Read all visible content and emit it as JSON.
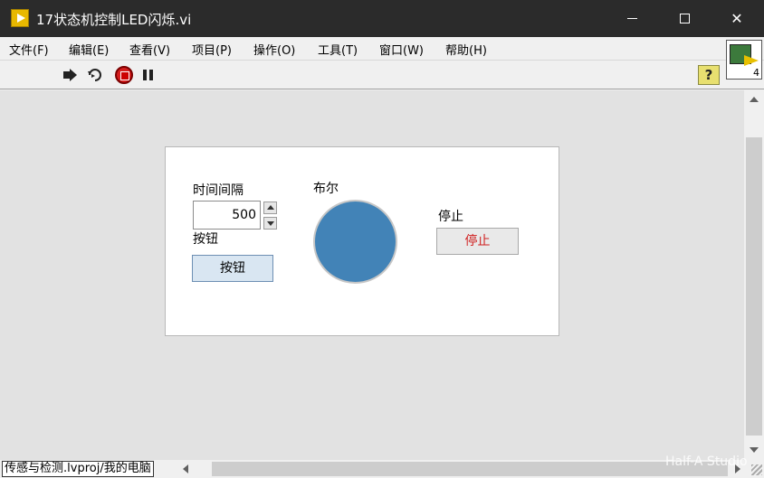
{
  "window": {
    "title": "17状态机控制LED闪烁.vi",
    "icon": "labview-vi-icon"
  },
  "menu": [
    "文件(F)",
    "编辑(E)",
    "查看(V)",
    "项目(P)",
    "操作(O)",
    "工具(T)",
    "窗口(W)",
    "帮助(H)"
  ],
  "toolbar": {
    "help_label": "?",
    "connector_number": "4"
  },
  "front_panel": {
    "numeric_label": "时间间隔",
    "numeric_value": "500",
    "button_label": "按钮",
    "button_text": "按钮",
    "led_label": "布尔",
    "led_color": "#4283b7",
    "stop_label": "停止",
    "stop_text": "停止"
  },
  "status": {
    "project_path": "传感与检测.lvproj/我的电脑",
    "watermark": "Half-A Studio"
  }
}
